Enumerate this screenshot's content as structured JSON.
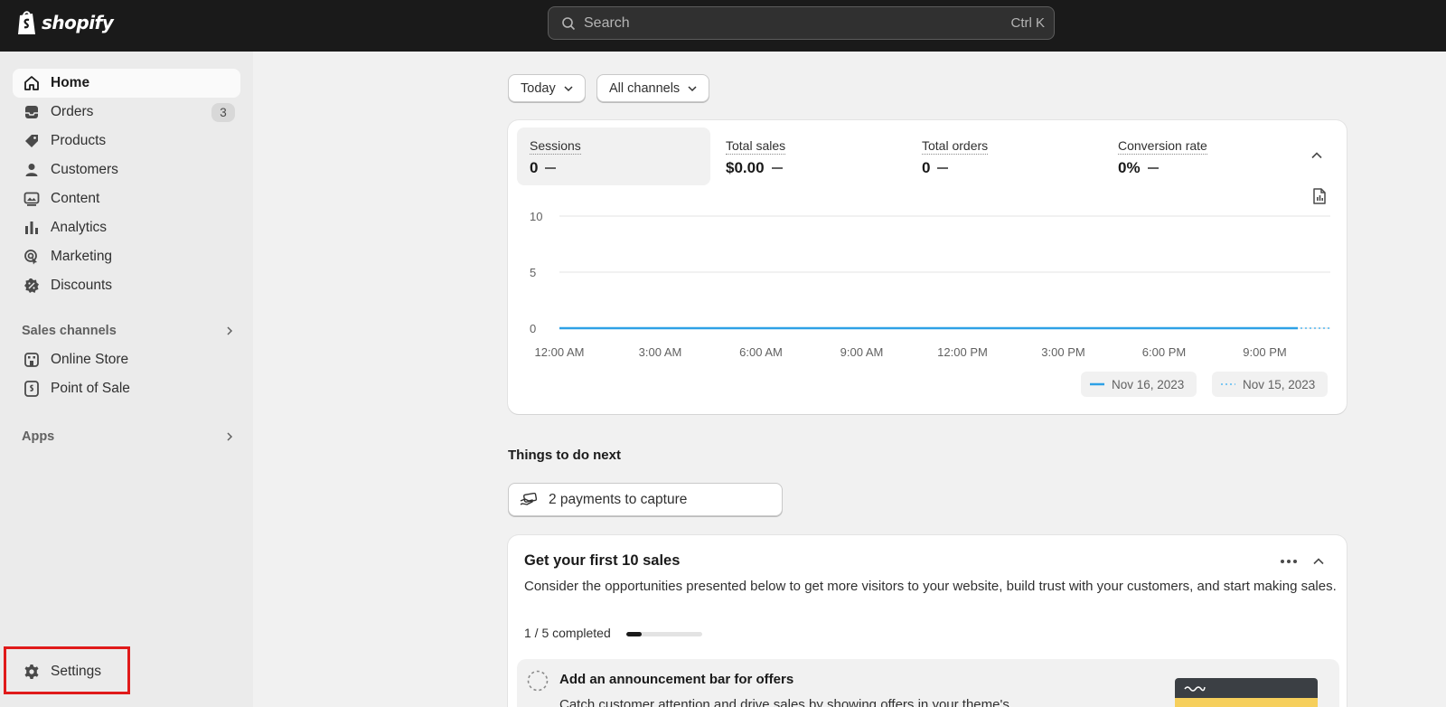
{
  "topbar": {
    "logo_text": "shopify",
    "search_placeholder": "Search",
    "search_shortcut": "Ctrl K"
  },
  "sidebar": {
    "items": [
      {
        "label": "Home",
        "icon": "home-icon",
        "active": true
      },
      {
        "label": "Orders",
        "icon": "orders-icon",
        "badge": "3"
      },
      {
        "label": "Products",
        "icon": "tag-icon"
      },
      {
        "label": "Customers",
        "icon": "person-icon"
      },
      {
        "label": "Content",
        "icon": "image-icon"
      },
      {
        "label": "Analytics",
        "icon": "bar-chart-icon"
      },
      {
        "label": "Marketing",
        "icon": "target-icon"
      },
      {
        "label": "Discounts",
        "icon": "discount-icon"
      }
    ],
    "sales_channels_label": "Sales channels",
    "channels": [
      {
        "label": "Online Store",
        "icon": "store-icon"
      },
      {
        "label": "Point of Sale",
        "icon": "pos-icon"
      }
    ],
    "apps_label": "Apps",
    "settings_label": "Settings"
  },
  "filters": {
    "date": "Today",
    "channel": "All channels"
  },
  "metrics": [
    {
      "label": "Sessions",
      "value": "0"
    },
    {
      "label": "Total sales",
      "value": "$0.00"
    },
    {
      "label": "Total orders",
      "value": "0"
    },
    {
      "label": "Conversion rate",
      "value": "0%"
    }
  ],
  "chart_data": {
    "type": "line",
    "x": [
      "12:00 AM",
      "3:00 AM",
      "6:00 AM",
      "9:00 AM",
      "12:00 PM",
      "3:00 PM",
      "6:00 PM",
      "9:00 PM"
    ],
    "yticks": [
      "10",
      "5",
      "0"
    ],
    "ylim": [
      0,
      10
    ],
    "series": [
      {
        "name": "Nov 16, 2023",
        "values": [
          0,
          0,
          0,
          0,
          0,
          0,
          0,
          0
        ],
        "color": "#2ea1e6",
        "style": "solid"
      },
      {
        "name": "Nov 15, 2023",
        "values": [
          0,
          0,
          0,
          0,
          0,
          0,
          0,
          0
        ],
        "color": "#7cc7f2",
        "style": "dotted"
      }
    ],
    "grid": true,
    "legend_placement": "bottom-right"
  },
  "things_to_do": {
    "title": "Things to do next",
    "payments_label": "2 payments to capture"
  },
  "first_sales": {
    "title": "Get your first 10 sales",
    "description": "Consider the opportunities presented below to get more visitors to your website, build trust with your customers, and start making sales.",
    "progress_text": "1 / 5 completed",
    "progress_fraction": 0.2,
    "task_title": "Add an announcement bar for offers",
    "task_desc": "Catch customer attention and drive sales by showing offers in your theme's"
  },
  "colors": {
    "topbar": "#1a1a1a",
    "accent_line": "#2ea1e6",
    "settings_highlight": "#e01a1a"
  }
}
